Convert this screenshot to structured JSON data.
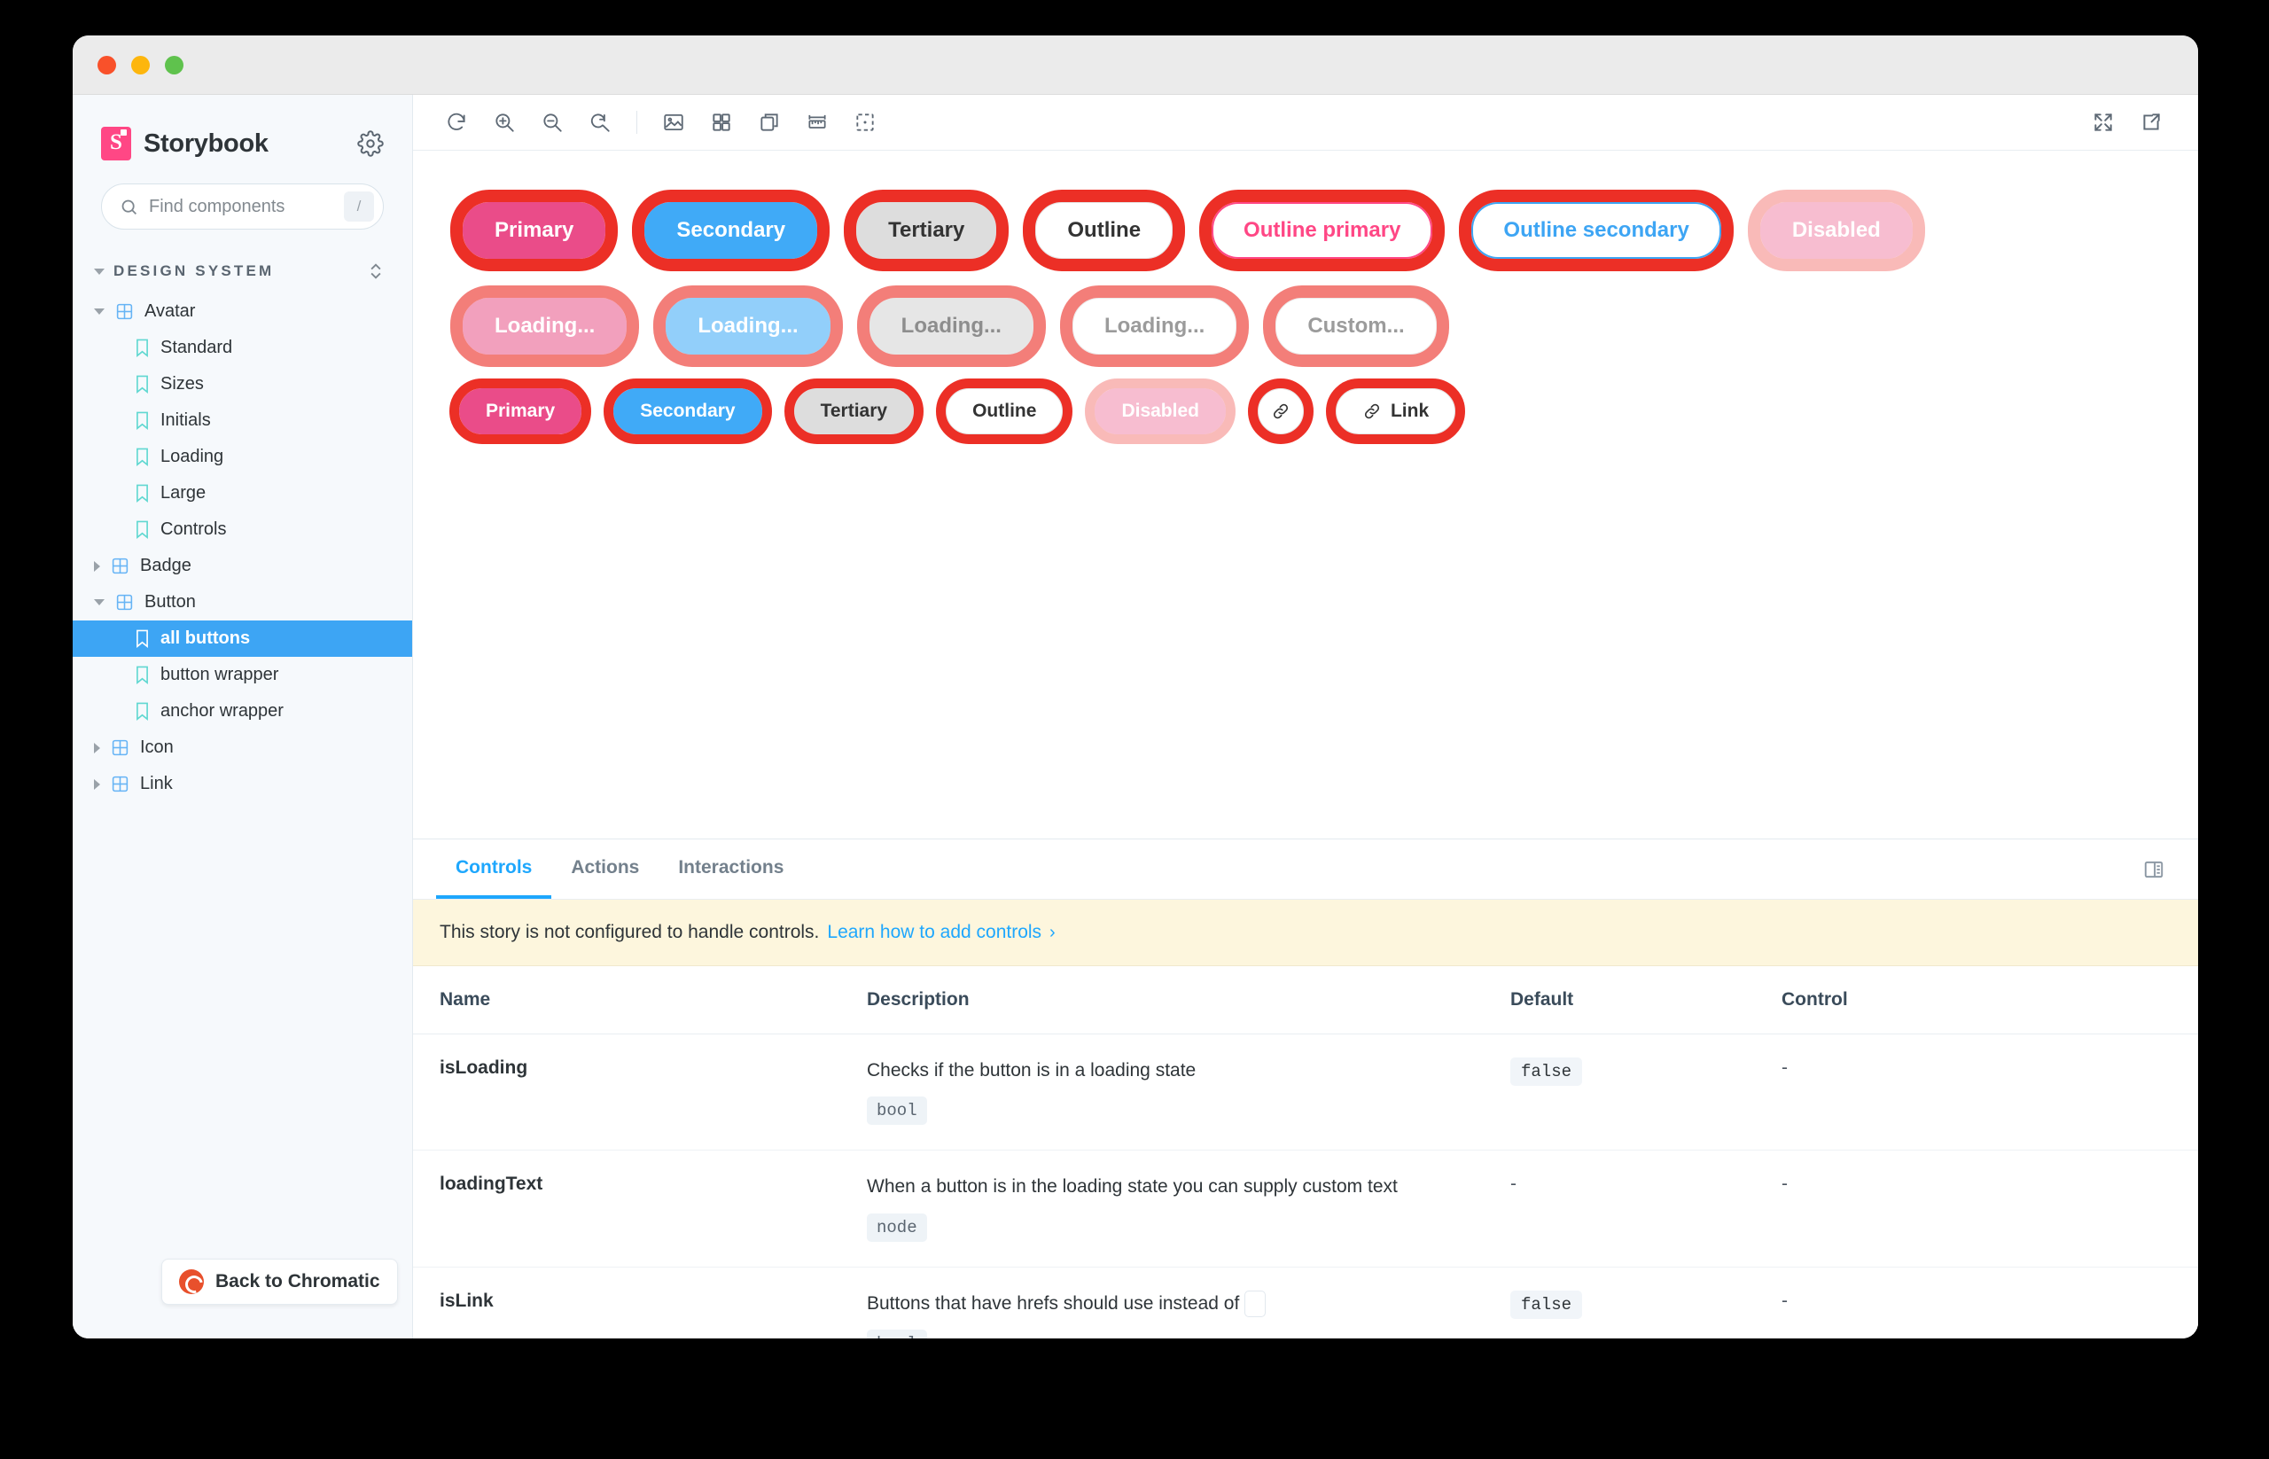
{
  "window": {
    "traffic_lights": [
      "close",
      "minimize",
      "zoom"
    ]
  },
  "sidebar": {
    "brand": "Storybook",
    "settings_icon": "gear-icon",
    "search": {
      "placeholder": "Find components",
      "shortcut": "/",
      "icon": "search-icon"
    },
    "section": {
      "label": "DESIGN SYSTEM",
      "sort_icon": "sort-chevrons-icon"
    },
    "tree": [
      {
        "label": "Avatar",
        "type": "component",
        "level": 0,
        "expanded": true,
        "selected": false
      },
      {
        "label": "Standard",
        "type": "story",
        "level": 1,
        "expanded": null,
        "selected": false
      },
      {
        "label": "Sizes",
        "type": "story",
        "level": 1,
        "expanded": null,
        "selected": false
      },
      {
        "label": "Initials",
        "type": "story",
        "level": 1,
        "expanded": null,
        "selected": false
      },
      {
        "label": "Loading",
        "type": "story",
        "level": 1,
        "expanded": null,
        "selected": false
      },
      {
        "label": "Large",
        "type": "story",
        "level": 1,
        "expanded": null,
        "selected": false
      },
      {
        "label": "Controls",
        "type": "story",
        "level": 1,
        "expanded": null,
        "selected": false
      },
      {
        "label": "Badge",
        "type": "component",
        "level": 0,
        "expanded": false,
        "selected": false
      },
      {
        "label": "Button",
        "type": "component",
        "level": 0,
        "expanded": true,
        "selected": false
      },
      {
        "label": "all buttons",
        "type": "story",
        "level": 1,
        "expanded": null,
        "selected": true
      },
      {
        "label": "button wrapper",
        "type": "story",
        "level": 1,
        "expanded": null,
        "selected": false
      },
      {
        "label": "anchor wrapper",
        "type": "story",
        "level": 1,
        "expanded": null,
        "selected": false
      },
      {
        "label": "Icon",
        "type": "component",
        "level": 0,
        "expanded": false,
        "selected": false
      },
      {
        "label": "Link",
        "type": "component",
        "level": 0,
        "expanded": false,
        "selected": false
      }
    ],
    "chromatic_button": {
      "label": "Back to Chromatic",
      "icon": "chromatic-logo-icon"
    }
  },
  "toolbar": {
    "left_tools": [
      {
        "name": "remount-icon",
        "title": "Remount component"
      },
      {
        "name": "zoom-in-icon",
        "title": "Zoom in"
      },
      {
        "name": "zoom-out-icon",
        "title": "Zoom out"
      },
      {
        "name": "zoom-reset-icon",
        "title": "Reset zoom"
      },
      {
        "name": "backgrounds-icon",
        "title": "Change background"
      },
      {
        "name": "grid-icon",
        "title": "Apply grid"
      },
      {
        "name": "viewport-icon",
        "title": "Change viewport"
      },
      {
        "name": "measure-icon",
        "title": "Measure"
      },
      {
        "name": "outline-icon",
        "title": "Outline"
      }
    ],
    "right_tools": [
      {
        "name": "fullscreen-icon",
        "title": "Go full screen"
      },
      {
        "name": "open-new-tab-icon",
        "title": "Open canvas in new tab"
      }
    ]
  },
  "canvas": {
    "rows": [
      {
        "name": "variants-row",
        "size": "md",
        "buttons": [
          {
            "label": "Primary",
            "variant": "primary",
            "ring": "solid",
            "icon": null
          },
          {
            "label": "Secondary",
            "variant": "secondary",
            "ring": "solid",
            "icon": null
          },
          {
            "label": "Tertiary",
            "variant": "tertiary",
            "ring": "solid",
            "icon": null
          },
          {
            "label": "Outline",
            "variant": "outline",
            "ring": "solid",
            "icon": null
          },
          {
            "label": "Outline primary",
            "variant": "outline-primary",
            "ring": "solid",
            "icon": null
          },
          {
            "label": "Outline secondary",
            "variant": "outline-secondary",
            "ring": "solid",
            "icon": null
          },
          {
            "label": "Disabled",
            "variant": "disabled",
            "ring": "faint",
            "icon": null
          }
        ]
      },
      {
        "name": "loading-row",
        "size": "md",
        "buttons": [
          {
            "label": "Loading...",
            "variant": "primary",
            "ring": "faded",
            "loading": true,
            "icon": null
          },
          {
            "label": "Loading...",
            "variant": "secondary",
            "ring": "faded",
            "loading": true,
            "icon": null
          },
          {
            "label": "Loading...",
            "variant": "tertiary",
            "ring": "faded",
            "loading": true,
            "icon": null
          },
          {
            "label": "Loading...",
            "variant": "outline",
            "ring": "faded",
            "loading": true,
            "icon": null
          },
          {
            "label": "Custom...",
            "variant": "outline",
            "ring": "faded",
            "loading": true,
            "icon": null
          }
        ]
      },
      {
        "name": "small-row",
        "size": "sm",
        "buttons": [
          {
            "label": "Primary",
            "variant": "primary",
            "ring": "solid",
            "icon": null
          },
          {
            "label": "Secondary",
            "variant": "secondary",
            "ring": "solid",
            "icon": null
          },
          {
            "label": "Tertiary",
            "variant": "tertiary",
            "ring": "solid",
            "icon": null
          },
          {
            "label": "Outline",
            "variant": "outline",
            "ring": "solid",
            "icon": null
          },
          {
            "label": "Disabled",
            "variant": "disabled",
            "ring": "faint",
            "icon": null
          },
          {
            "label": "",
            "variant": "outline",
            "ring": "solid",
            "icon": "link-icon",
            "icon_only": true
          },
          {
            "label": "Link",
            "variant": "outline",
            "ring": "solid",
            "icon": "link-icon"
          }
        ]
      }
    ]
  },
  "addons": {
    "tabs": [
      {
        "label": "Controls",
        "active": true
      },
      {
        "label": "Actions",
        "active": false
      },
      {
        "label": "Interactions",
        "active": false
      }
    ],
    "panel_position_icon": "panel-layout-icon",
    "notice": {
      "text": "This story is not configured to handle controls.",
      "link": "Learn how to add controls",
      "chevron": "›"
    },
    "table": {
      "headers": [
        "Name",
        "Description",
        "Default",
        "Control"
      ],
      "rows": [
        {
          "name": "isLoading",
          "description": "Checks if the button is in a loading state",
          "type": "bool",
          "default": "false",
          "control": "-"
        },
        {
          "name": "loadingText",
          "description": "When a button is in the loading state you can supply custom text",
          "type": "node",
          "default": "-",
          "control": "-"
        },
        {
          "name": "isLink",
          "description": "Buttons that have hrefs should use instead of",
          "description_suffix_code": "",
          "type": "bool",
          "default": "false",
          "control": "-"
        }
      ]
    }
  },
  "colors": {
    "accent_blue": "#1ea7fd",
    "brand_pink": "#ff4785",
    "outline_red": "#ec2f26",
    "sidebar_bg": "#f6f9fc",
    "notice_bg": "#fdf6dd",
    "chromatic_orange": "#e8502c",
    "selected_row": "#3da5f4"
  }
}
